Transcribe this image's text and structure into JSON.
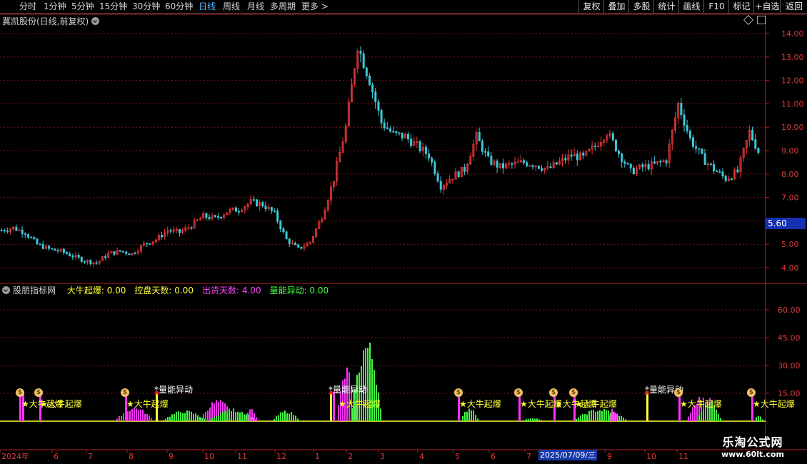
{
  "toolbar": {
    "periods": [
      "分时",
      "1分钟",
      "5分钟",
      "15分钟",
      "30分钟",
      "60分钟",
      "日线",
      "周线",
      "月线",
      "多周期",
      "更多 >"
    ],
    "active": "日线",
    "right_buttons": [
      "复权",
      "叠加",
      "多股",
      "统计",
      "画线",
      "F10",
      "标记",
      "+自选",
      "返回"
    ]
  },
  "chart": {
    "title": "冀凯股份(日线,前复权)",
    "price_ticks": [
      "14.00",
      "13.00",
      "12.00",
      "11.00",
      "10.00",
      "9.00",
      "8.00",
      "7.00",
      "6.00",
      "5.00",
      "4.00"
    ],
    "current_price": "5.60",
    "colors": {
      "up": "#e8383a",
      "down": "#3ec8d8",
      "grid": "#7a1515",
      "axis": "#b02020"
    }
  },
  "indicator": {
    "name": "股朋指标网",
    "fields": [
      {
        "label": "大牛起爆: 0.00",
        "color": "#ffff33"
      },
      {
        "label": "控盘天数: 0.00",
        "color": "#ffff33"
      },
      {
        "label": "出货天数: 4.00",
        "color": "#ff44ff"
      },
      {
        "label": "量能异动: 0.00",
        "color": "#44ff44"
      }
    ],
    "ticks": [
      "60.00",
      "45.00",
      "30.00",
      "15.00"
    ],
    "signal_text": "★大牛起爆",
    "volume_text": "量能异动"
  },
  "x_axis": {
    "labels": [
      "2024年",
      "6",
      "7",
      "8",
      "9",
      "10",
      "11",
      "12",
      "1",
      "2",
      "3",
      "4",
      "5",
      "6",
      "7",
      "9",
      "10",
      "11"
    ],
    "cursor_date": "2025/07/09/三"
  },
  "watermark": {
    "line1": "乐淘公式网",
    "line2": "www.60lt.com"
  },
  "chart_data": {
    "type": "candlestick",
    "title": "冀凯股份(日线,前复权)",
    "ylim": [
      3.5,
      14.5
    ],
    "series": [
      {
        "name": "close_approx",
        "values": [
          5.6,
          5.7,
          5.5,
          5.0,
          4.8,
          4.7,
          4.5,
          4.3,
          4.2,
          4.6,
          4.7,
          4.6,
          5.0,
          5.2,
          5.6,
          5.5,
          5.8,
          6.2,
          6.1,
          6.4,
          6.5,
          6.8,
          6.7,
          6.3,
          5.2,
          4.8,
          5.1,
          6.2,
          7.8,
          10.0,
          13.5,
          12.0,
          10.2,
          9.7,
          9.6,
          9.2,
          8.8,
          7.5,
          7.9,
          8.2,
          9.6,
          8.6,
          8.3,
          8.4,
          8.5,
          8.4,
          8.2,
          8.5,
          8.8,
          8.7,
          9.2,
          9.8,
          8.9,
          8.1,
          8.3,
          8.4,
          8.6,
          11.0,
          9.5,
          8.7,
          8.2,
          7.8,
          8.1,
          9.8,
          8.7
        ]
      }
    ]
  }
}
